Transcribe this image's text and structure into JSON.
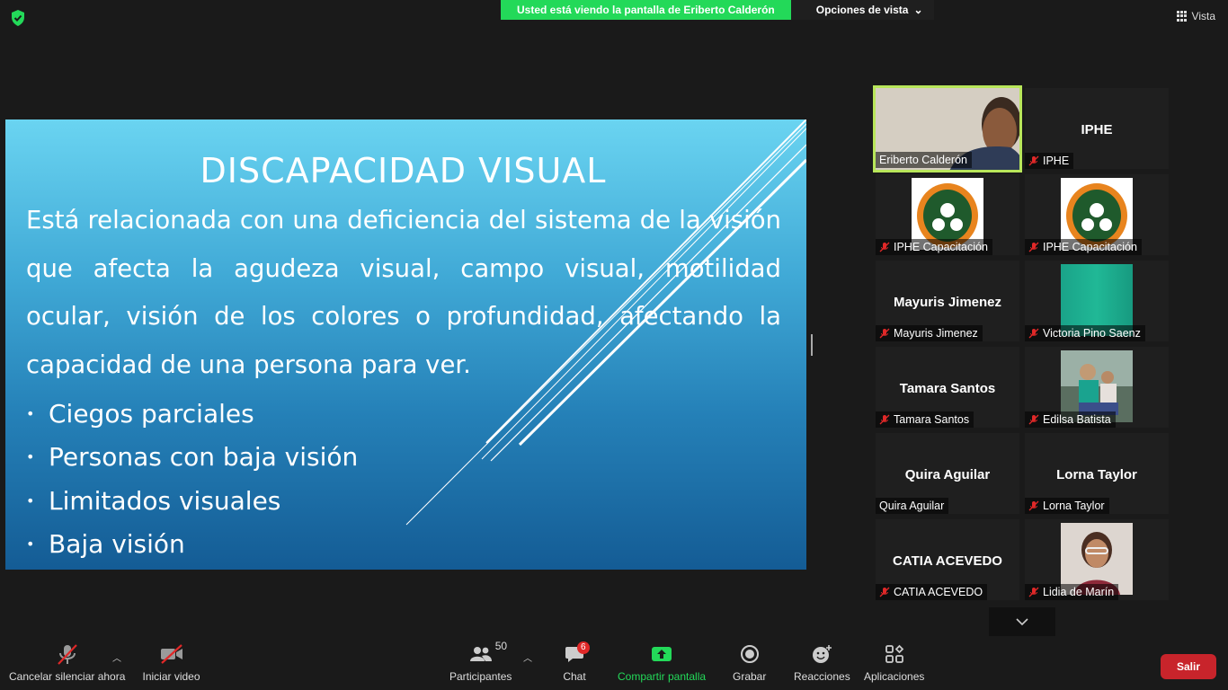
{
  "topbar": {
    "banner_text": "Usted está viendo la pantalla de Eriberto Calderón",
    "view_options": "Opciones de vista",
    "view_label": "Vista"
  },
  "slide": {
    "title": "DISCAPACIDAD VISUAL",
    "body": "Está relacionada con una  deficiencia  del sistema de la visión que afecta la agudeza visual, campo visual, motilidad ocular, visión de los colores o profundidad, afectando la capacidad de una persona para ver.",
    "bullets": [
      "Ciegos parciales",
      "Personas con baja visión",
      "Limitados visuales",
      "Baja visión"
    ]
  },
  "participants": [
    {
      "label": "Eriberto Calderón",
      "muted": false,
      "type": "video"
    },
    {
      "label": "IPHE",
      "name": "IPHE",
      "muted": true,
      "type": "name"
    },
    {
      "label": "IPHE Capacitación",
      "muted": true,
      "type": "logo"
    },
    {
      "label": "IPHE Capacitación",
      "muted": true,
      "type": "logo"
    },
    {
      "label": "Mayuris Jimenez",
      "name": "Mayuris Jimenez",
      "muted": true,
      "type": "name"
    },
    {
      "label": "Victoria Pino Saenz",
      "muted": true,
      "type": "color"
    },
    {
      "label": "Tamara Santos",
      "name": "Tamara Santos",
      "muted": true,
      "type": "name"
    },
    {
      "label": "Edilsa Batista",
      "muted": true,
      "type": "photo"
    },
    {
      "label": "Quira Aguilar",
      "name": "Quira Aguilar",
      "muted": false,
      "type": "name"
    },
    {
      "label": "Lorna  Taylor",
      "name": "Lorna  Taylor",
      "muted": true,
      "type": "name"
    },
    {
      "label": "CATIA ACEVEDO",
      "name": "CATIA ACEVEDO",
      "muted": true,
      "type": "name"
    },
    {
      "label": "Lidia de Marín",
      "muted": true,
      "type": "photo"
    }
  ],
  "toolbar": {
    "mute_label": "Cancelar silenciar ahora",
    "video_label": "Iniciar video",
    "participants_label": "Participantes",
    "participants_count": "50",
    "chat_label": "Chat",
    "chat_badge": "6",
    "share_label": "Compartir pantalla",
    "record_label": "Grabar",
    "reactions_label": "Reacciones",
    "apps_label": "Aplicaciones",
    "leave_label": "Salir"
  },
  "colors": {
    "banner_green": "#23d959",
    "active_speaker": "#b8e65a",
    "leave_red": "#c8242b",
    "mute_red": "#e02828"
  }
}
